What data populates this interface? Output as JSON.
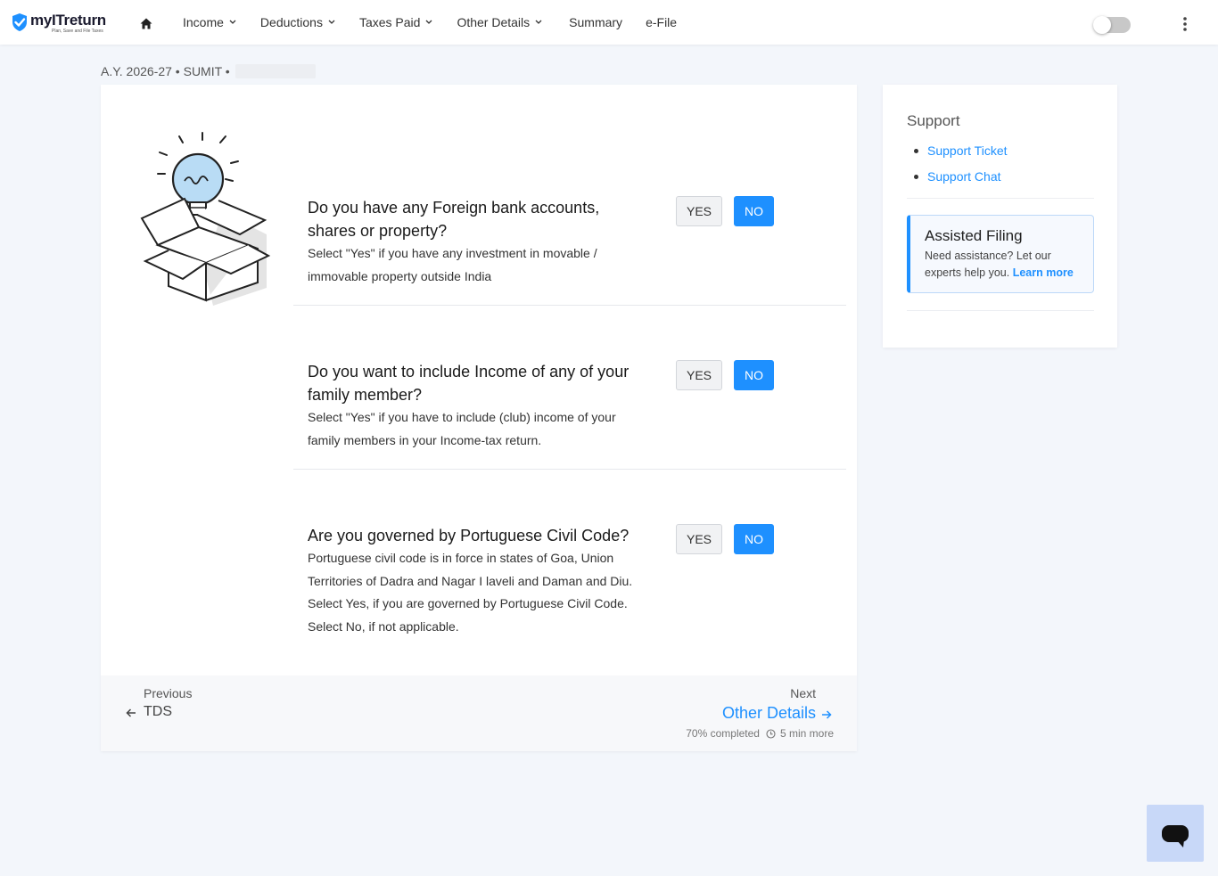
{
  "brand": {
    "name": "myITreturn",
    "tagline": "Plan, Save and File Taxes",
    "accent": "#1e90ff"
  },
  "nav": {
    "items": [
      {
        "label": "Income",
        "has_dropdown": true
      },
      {
        "label": "Deductions",
        "has_dropdown": true
      },
      {
        "label": "Taxes Paid",
        "has_dropdown": true
      },
      {
        "label": "Other Details",
        "has_dropdown": true
      },
      {
        "label": "Summary",
        "has_dropdown": false
      },
      {
        "label": "e-File",
        "has_dropdown": false
      }
    ],
    "toggle_on": false
  },
  "breadcrumb": {
    "text": "A.Y. 2026-27 • SUMIT •"
  },
  "questions": [
    {
      "title": "Do you have any Foreign bank accounts, shares or property?",
      "description": "Select \"Yes\" if you have any investment in movable / immovable property outside India",
      "yes_label": "YES",
      "no_label": "NO",
      "selected": "NO"
    },
    {
      "title": "Do you want to include Income of any of your family member?",
      "description": "Select \"Yes\" if you have to include (club) income of your family members in your Income-tax return.",
      "yes_label": "YES",
      "no_label": "NO",
      "selected": "NO"
    },
    {
      "title": "Are you governed by Portuguese Civil Code?",
      "description": "Portuguese civil code is in force in states of Goa, Union Territories of Dadra and Nagar I laveli and Daman and Diu. Select Yes, if you are governed by Portuguese Civil Code. Select No, if not applicable.",
      "yes_label": "YES",
      "no_label": "NO",
      "selected": "NO"
    }
  ],
  "footer": {
    "previous_label": "Previous",
    "previous_link": "TDS",
    "next_label": "Next",
    "next_link": "Other Details",
    "progress_text": "70% completed",
    "time_text": "5 min more"
  },
  "sidebar": {
    "support_title": "Support",
    "support_links": [
      "Support Ticket",
      "Support Chat"
    ],
    "assisted_title": "Assisted Filing",
    "assisted_desc": "Need assistance? Let our experts help you.",
    "assisted_link": "Learn more"
  }
}
